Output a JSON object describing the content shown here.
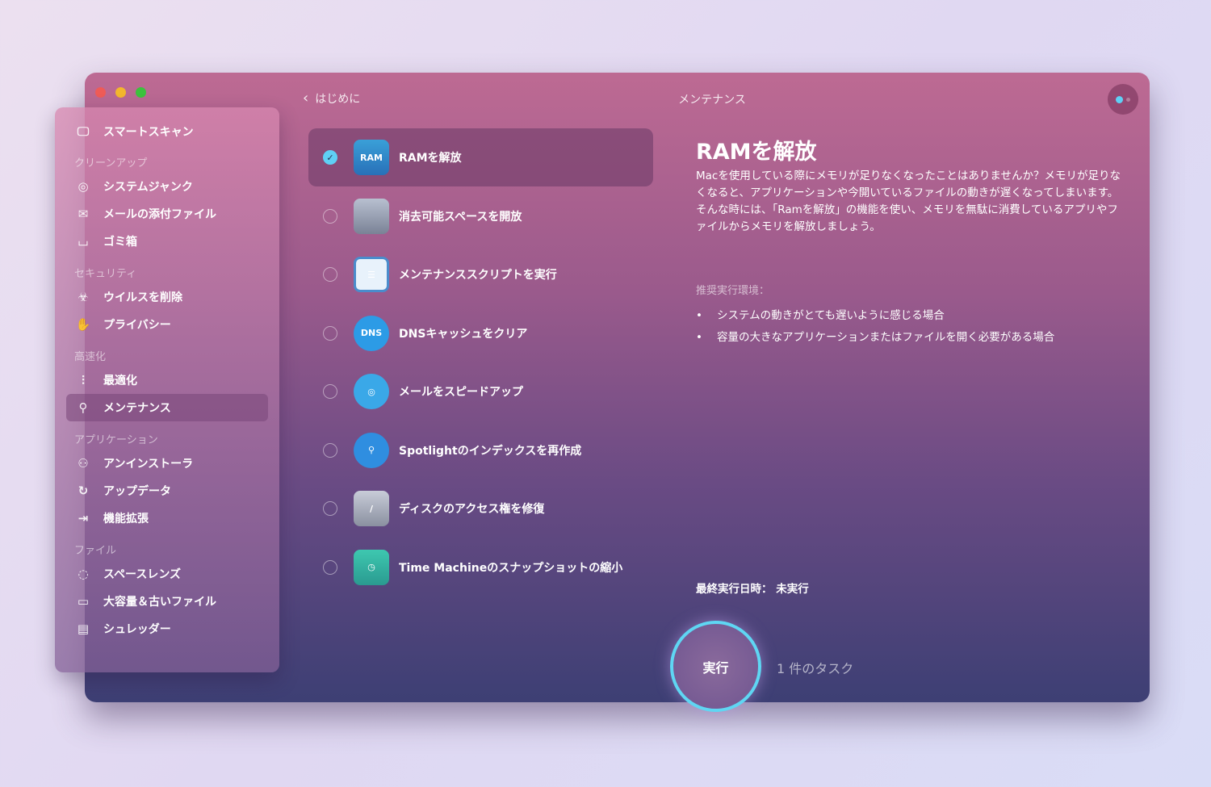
{
  "window": {
    "back_label": "はじめに",
    "title": "メンテナンス"
  },
  "sidebar": {
    "smart_scan": "スマートスキャン",
    "sections": [
      {
        "label": "クリーンアップ",
        "items": [
          "システムジャンク",
          "メールの添付ファイル",
          "ゴミ箱"
        ]
      },
      {
        "label": "セキュリティ",
        "items": [
          "ウイルスを削除",
          "プライバシー"
        ]
      },
      {
        "label": "高速化",
        "items": [
          "最適化",
          "メンテナンス"
        ]
      },
      {
        "label": "アプリケーション",
        "items": [
          "アンインストーラ",
          "アップデータ",
          "機能拡張"
        ]
      },
      {
        "label": "ファイル",
        "items": [
          "スペースレンズ",
          "大容量＆古いファイル",
          "シュレッダー"
        ]
      }
    ],
    "active": "メンテナンス"
  },
  "tasks": [
    {
      "label": "RAMを解放",
      "checked": true,
      "icon_text": "RAM"
    },
    {
      "label": "消去可能スペースを開放",
      "checked": false
    },
    {
      "label": "メンテナンススクリプトを実行",
      "checked": false
    },
    {
      "label": "DNSキャッシュをクリア",
      "checked": false,
      "icon_text": "DNS"
    },
    {
      "label": "メールをスピードアップ",
      "checked": false
    },
    {
      "label": "Spotlightのインデックスを再作成",
      "checked": false
    },
    {
      "label": "ディスクのアクセス権を修復",
      "checked": false
    },
    {
      "label": "Time Machineのスナップショットの縮小",
      "checked": false
    }
  ],
  "detail": {
    "title": "RAMを解放",
    "description": "Macを使用している際にメモリが足りなくなったことはありませんか？メモリが足りなくなると、アプリケーションや今開いているファイルの動きが遅くなってしまいます。そんな時には、「Ramを解放」の機能を使い、メモリを無駄に消費しているアプリやファイルからメモリを解放しましょう。",
    "recommended_label": "推奨実行環境：",
    "recommended": [
      "システムの動きがとても遅いように感じる場合",
      "容量の大きなアプリケーションまたはファイルを開く必要がある場合"
    ],
    "last_run": "最終実行日時： 未実行"
  },
  "footer": {
    "run_label": "実行",
    "task_count": "1 件のタスク"
  }
}
